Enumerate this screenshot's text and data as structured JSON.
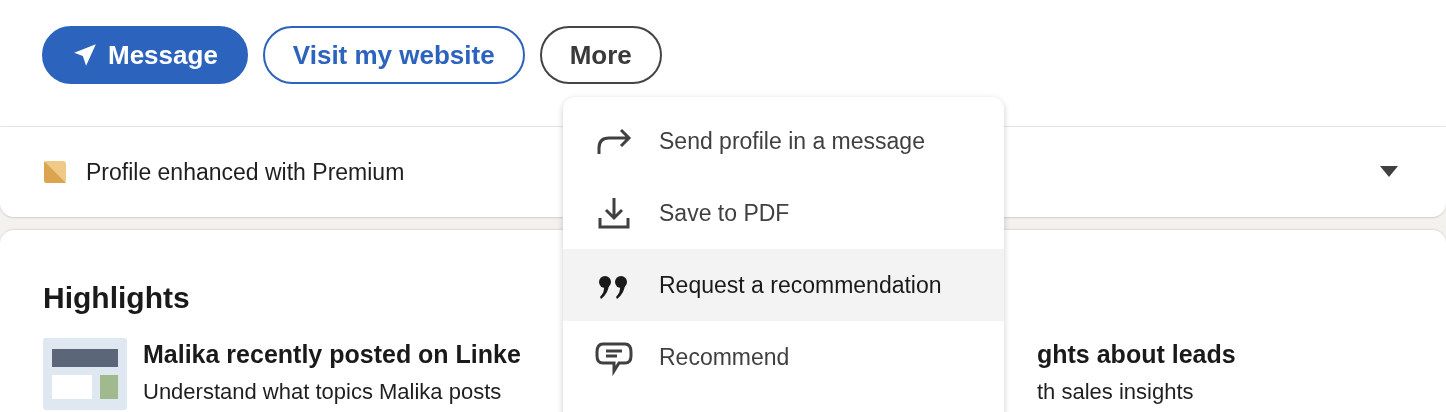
{
  "actions": [
    {
      "label": "Message",
      "kind": "primary"
    },
    {
      "label": "Visit my website",
      "kind": "outline"
    },
    {
      "label": "More",
      "kind": "secondary"
    }
  ],
  "premium_bar": {
    "label": "Profile enhanced with Premium",
    "expanded": false
  },
  "highlights": {
    "title": "Highlights",
    "items": [
      {
        "title_left": "Malika recently posted on Linke",
        "title_right": "ghts about leads",
        "subtitle_left": "Understand what topics Malika posts",
        "subtitle_right": "th sales insights"
      }
    ]
  },
  "more_menu": [
    {
      "label": "Send profile in a message",
      "kind": "share",
      "selected": false
    },
    {
      "label": "Save to PDF",
      "kind": "download",
      "selected": false
    },
    {
      "label": "Request a recommendation",
      "kind": "quote",
      "selected": true
    },
    {
      "label": "Recommend",
      "kind": "comment",
      "selected": false
    }
  ]
}
